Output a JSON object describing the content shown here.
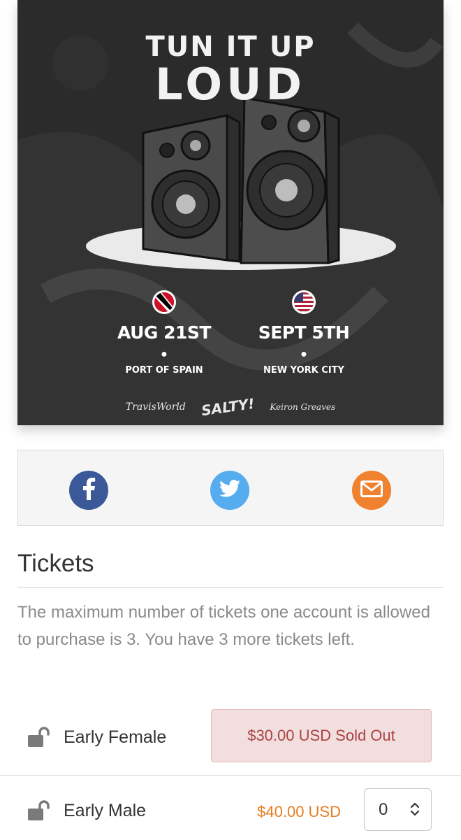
{
  "poster": {
    "title_line1": "TUN IT UP",
    "title_line2": "LOUD",
    "events": [
      {
        "date": "AUG 21ST",
        "city": "PORT OF SPAIN"
      },
      {
        "date": "SEPT 5TH",
        "city": "NEW YORK CITY"
      }
    ],
    "sponsors": [
      "TravisWorld",
      "SALTY!",
      "Keiron Greaves"
    ]
  },
  "share": {
    "icons": [
      "facebook-icon",
      "twitter-icon",
      "email-icon"
    ],
    "colors": {
      "facebook": "#3b5998",
      "twitter": "#55acee",
      "email": "#f0812f"
    }
  },
  "tickets": {
    "heading": "Tickets",
    "notice": "The maximum number of tickets one account is allowed to purchase is 3. You have 3 more tickets left.",
    "items": [
      {
        "name": "Early Female",
        "status": "$30.00 USD Sold Out"
      },
      {
        "name": "Early Male",
        "price": "$40.00 USD",
        "quantity": "0"
      }
    ]
  }
}
